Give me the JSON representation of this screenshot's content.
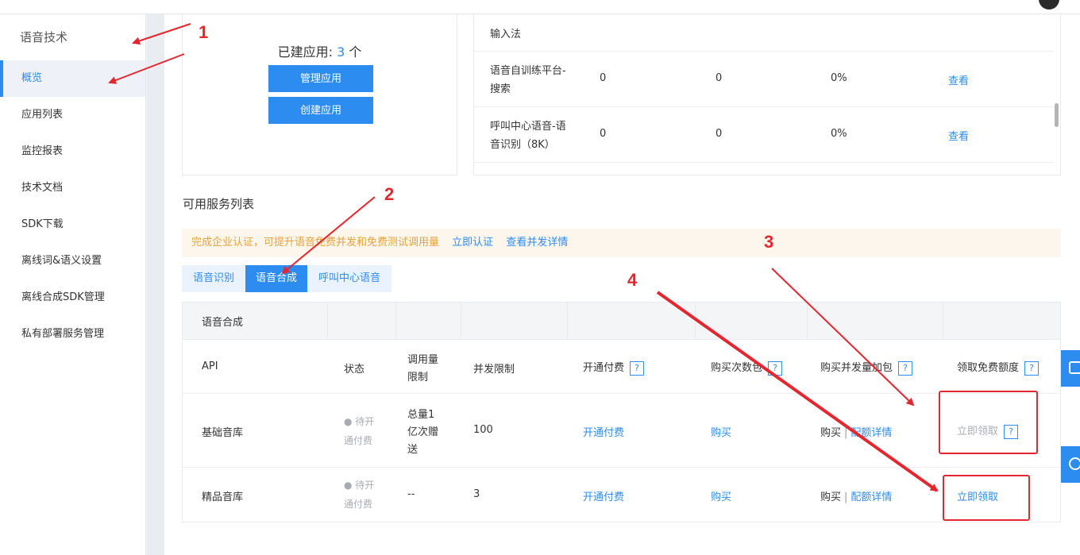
{
  "sidebar": {
    "title": "语音技术",
    "items": [
      {
        "label": "概览",
        "active": true
      },
      {
        "label": "应用列表"
      },
      {
        "label": "监控报表"
      },
      {
        "label": "技术文档"
      },
      {
        "label": "SDK下载"
      },
      {
        "label": "离线词&语义设置"
      },
      {
        "label": "离线合成SDK管理"
      },
      {
        "label": "私有部署服务管理"
      }
    ]
  },
  "apps": {
    "prefix": "已建应用:",
    "count": "3",
    "suffix": "个",
    "manage_button": "管理应用",
    "create_button": "创建应用"
  },
  "quota_table": {
    "rows": [
      {
        "name": "输入法",
        "col2": "",
        "col3": "",
        "col4": "",
        "action": ""
      },
      {
        "name_l1": "语音自训练平台-",
        "name_l2": "搜索",
        "col2": "0",
        "col3": "0",
        "col4": "0%",
        "action": "查看"
      },
      {
        "name_l1": "呼叫中心语音-语",
        "name_l2": "音识别（8K）",
        "col2": "0",
        "col3": "0",
        "col4": "0%",
        "action": "查看"
      }
    ]
  },
  "services": {
    "title": "可用服务列表",
    "notice": {
      "text": "完成企业认证，可提升语音免费并发和免费测试调用量",
      "link1": "立即认证",
      "link2": "查看并发详情"
    },
    "tabs": [
      {
        "label": "语音识别",
        "active": false
      },
      {
        "label": "语音合成",
        "active": true
      },
      {
        "label": "呼叫中心语音",
        "active": false
      }
    ],
    "table_title": "语音合成",
    "headers": {
      "api": "API",
      "status": "状态",
      "quota_l1": "调用量",
      "quota_l2": "限制",
      "concurrency": "并发限制",
      "pay": "开通付费",
      "buy_count": "购买次数包",
      "buy_concurrency": "购买并发量加包",
      "free": "领取免费额度",
      "help": "?"
    },
    "rows": [
      {
        "api": "基础音库",
        "status_l1": "● 待开",
        "status_l2": "通付费",
        "quota_l1": "总量1",
        "quota_l2": "亿次赠",
        "quota_l3": "送",
        "concurrency": "100",
        "pay": "开通付费",
        "buy_count": "购买",
        "buy_conc_a": "购买",
        "buy_conc_sep": "|",
        "buy_conc_b": "配额详情",
        "free": "立即领取"
      },
      {
        "api": "精品音库",
        "status_l1": "● 待开",
        "status_l2": "通付费",
        "quota_l1": "--",
        "concurrency": "3",
        "pay": "开通付费",
        "buy_count": "购买",
        "buy_conc_a": "购买",
        "buy_conc_sep": "|",
        "buy_conc_b": "配额详情",
        "free": "立即领取"
      }
    ]
  },
  "annotations": {
    "labels": [
      "1",
      "2",
      "3",
      "4"
    ],
    "color": "#e5262e"
  },
  "colors": {
    "accent": "#2d8cf0",
    "warning_text": "#e6a23c",
    "annotation": "#e5262e"
  }
}
